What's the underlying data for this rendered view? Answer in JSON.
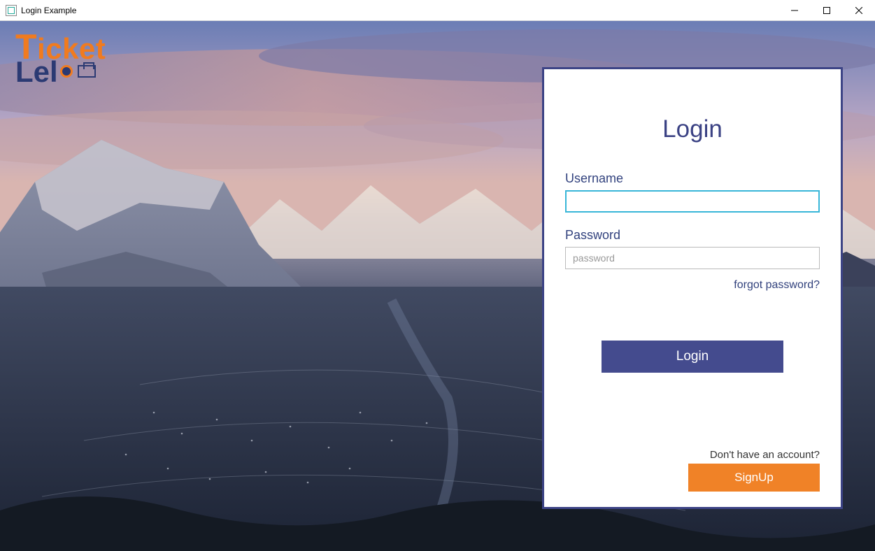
{
  "window": {
    "title": "Login Example"
  },
  "logo": {
    "line1": "Ticket",
    "line2": "Lel"
  },
  "login_card": {
    "title": "Login",
    "username_label": "Username",
    "username_value": "",
    "password_label": "Password",
    "password_placeholder": "password",
    "password_value": "",
    "forgot_link": "forgot password?",
    "login_button": "Login",
    "signup_prompt": "Don't have an account?",
    "signup_button": "SignUp"
  },
  "colors": {
    "accent_primary": "#444b8e",
    "accent_secondary": "#f08227",
    "focus_border": "#38b6d8"
  }
}
